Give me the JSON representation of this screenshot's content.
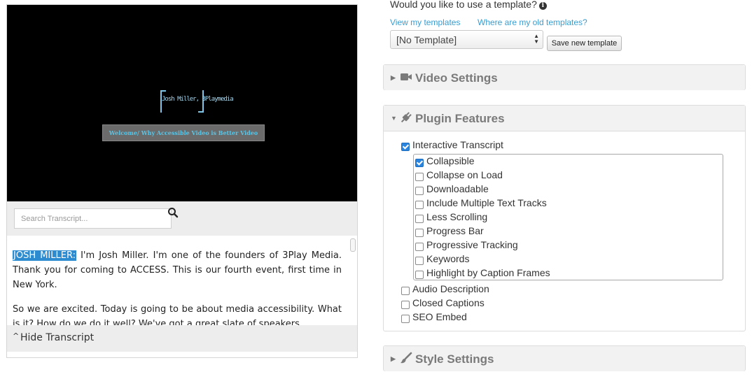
{
  "video": {
    "logo_text": "Josh Miller, 3Playmedia",
    "caption": "Welcome/ Why Accessible Video is Better Video"
  },
  "search": {
    "placeholder": "Search Transcript..."
  },
  "transcript": {
    "speaker": "JOSH MILLER:",
    "para1": " I'm Josh Miller. I'm one of the founders of 3Play Media. Thank you for coming to ACCESS. This is our fourth event, first time in New York.",
    "para2": "So we are excited. Today is going to be about media accessibility. What is it? How do we do it well? We've got a great slate of speakers"
  },
  "hide_transcript_label": "Hide Transcript",
  "template": {
    "question": "Would you like to use a template?",
    "view_link": "View my templates",
    "old_link": "Where are my old templates?",
    "selected": "[No Template]",
    "save_button": "Save new template"
  },
  "panels": {
    "video_settings": "Video Settings",
    "plugin_features": "Plugin Features",
    "style_settings": "Style Settings"
  },
  "features": {
    "interactive_transcript": {
      "label": "Interactive Transcript",
      "checked": true
    },
    "sub_options": [
      {
        "label": "Collapsible",
        "checked": true
      },
      {
        "label": "Collapse on Load",
        "checked": false
      },
      {
        "label": "Downloadable",
        "checked": false
      },
      {
        "label": "Include Multiple Text Tracks",
        "checked": false
      },
      {
        "label": "Less Scrolling",
        "checked": false
      },
      {
        "label": "Progress Bar",
        "checked": false
      },
      {
        "label": "Progressive Tracking",
        "checked": false
      },
      {
        "label": "Keywords",
        "checked": false
      },
      {
        "label": "Highlight by Caption Frames",
        "checked": false
      }
    ],
    "audio_description": {
      "label": "Audio Description",
      "checked": false
    },
    "closed_captions": {
      "label": "Closed Captions",
      "checked": false
    },
    "seo_embed": {
      "label": "SEO Embed",
      "checked": false
    }
  },
  "colors": {
    "link": "#3a9dd0",
    "speaker_highlight": "#2d8bd0",
    "checkbox_checked": "#2a85e0"
  },
  "icons": {
    "video_settings": "video-camera-icon",
    "plugin_features": "plug-icon",
    "style_settings": "paintbrush-icon",
    "search": "search-icon",
    "info": "info-icon"
  }
}
